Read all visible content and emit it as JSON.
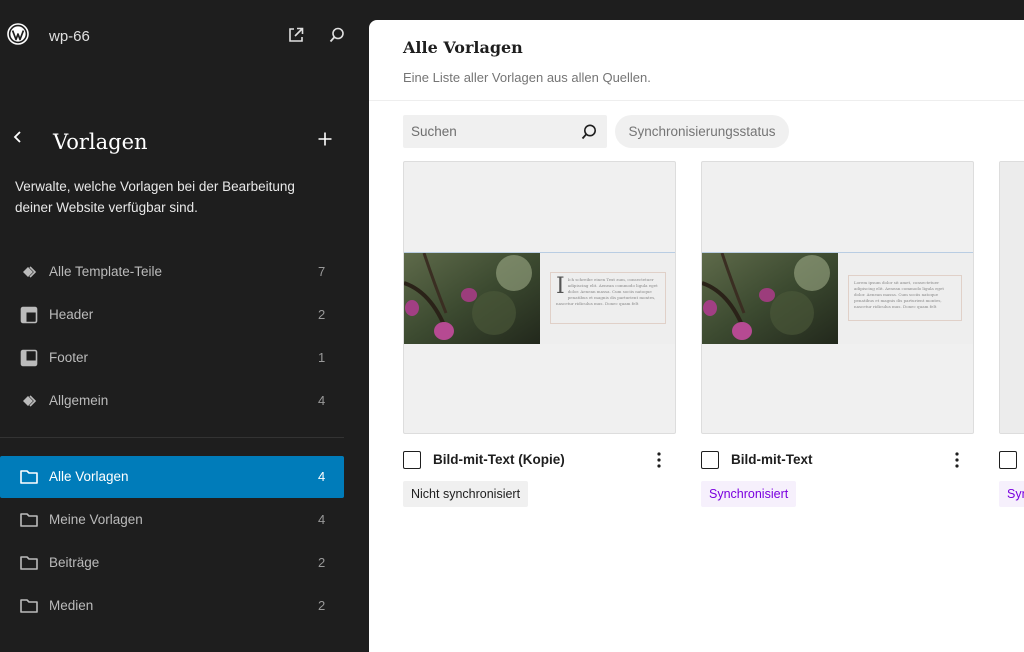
{
  "site": {
    "name": "wp-66"
  },
  "navigation": {
    "title": "Vorlagen",
    "description": "Verwalte, welche Vorlagen bei der Bearbeitung deiner Website verfügbar sind.",
    "template_parts": [
      {
        "label": "Alle Template-Teile",
        "count": "7",
        "icon": "diamond-icon"
      },
      {
        "label": "Header",
        "count": "2",
        "icon": "header-layout-icon"
      },
      {
        "label": "Footer",
        "count": "1",
        "icon": "footer-layout-icon"
      },
      {
        "label": "Allgemein",
        "count": "4",
        "icon": "diamond-icon"
      }
    ],
    "categories": [
      {
        "label": "Alle Vorlagen",
        "count": "4",
        "icon": "folder-icon",
        "active": true
      },
      {
        "label": "Meine Vorlagen",
        "count": "4",
        "icon": "folder-icon"
      },
      {
        "label": "Beiträge",
        "count": "2",
        "icon": "folder-icon"
      },
      {
        "label": "Medien",
        "count": "2",
        "icon": "folder-icon"
      }
    ]
  },
  "main": {
    "title": "Alle Vorlagen",
    "description": "Eine Liste aller Vorlagen aus allen Quellen.",
    "search": {
      "placeholder": "Suchen"
    },
    "sync_filter_label": "Synchronisierungsstatus",
    "patterns": [
      {
        "title": "Bild-mit-Text (Kopie)",
        "status": "Nicht synchronisiert",
        "status_type": "unsynced",
        "preview_text": "Ich schreibe einen Text zum, consectetuer adipiscing elit. Aenean commodo ligula eget dolor. Aenean massa. Cum sociis natoque penatibus et magnis dis parturient montes, nascetur ridiculus mus. Donec quam felt"
      },
      {
        "title": "Bild-mit-Text",
        "status": "Synchronisiert",
        "status_type": "synced",
        "preview_text": "Lorem ipsum dolor sit amet, consectetuer adipiscing elit. Aenean commodo ligula eget dolor. Aenean massa. Cum sociis natoque penatibus et magnis dis parturient montes, nascetur ridiculus mus. Donec quam felt"
      },
      {
        "title": "",
        "status": "Syn",
        "status_type": "synced",
        "preview_text": ""
      }
    ]
  },
  "colors": {
    "accent": "#007cba",
    "synced": "#7a00df",
    "sidebar_bg": "#1e1e1e"
  }
}
